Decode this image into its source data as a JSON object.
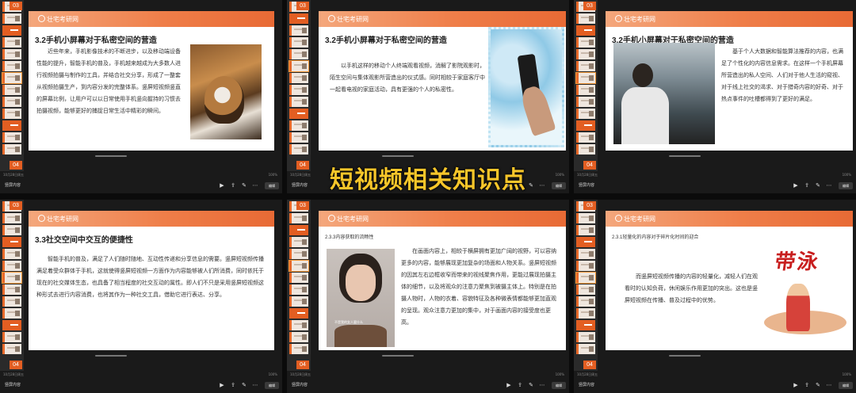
{
  "app": {
    "doc_name": "竖屏内容",
    "edit_label": "编辑",
    "status_time": "10月28日周五",
    "battery": "100%"
  },
  "overlay_caption": "短视频相关知识点",
  "logo_text": "壮宅考研网",
  "icons": [
    "play-icon",
    "share-icon",
    "pen-icon",
    "more-icon"
  ],
  "slides": [
    {
      "title": "3.2手机小屏幕对于私密空间的营造",
      "body": "近些年来，手机影像技术的不断进步，以及移动端设备性能的提升，智能手机的普及，手机越来越成为大多数人进行视频拍摄与制作的工具，并结合社交分享，形成了一整套从视频拍摄生产，到内容分发的完整体系。竖屏短视频竖直的屏幕比例，让用户可以以日常使用手机竖向握持的习惯去拍摄视频，能够更好的捕捉日常生活中精彩的瞬间。",
      "top_num": "03",
      "bot_num": "04"
    },
    {
      "title": "3.2手机小屏幕对于私密空间的营造",
      "body": "以手机这样的移动个人终端观看视频，消解了影院观影时，陌生空间与集体观影所营造出的仪式感。同时相较于家庭客厅中一起看电视的家庭活动，具有更强的个人的私密性。",
      "top_num": "03",
      "bot_num": "04"
    },
    {
      "title": "3.2手机小屏幕对于私密空间的营造",
      "body": "基于个人大数据和智能算法推荐的内容，也满足了个性化的内容信息需求。在这样一个手机屏幕所营造出的私人空间、人们对于他人生活的窥视、对于线上社交的渴求、对于猎奇内容的好奇、对于热点事件的吐槽都得到了更好的满足。",
      "top_num": "03",
      "bot_num": "04"
    },
    {
      "title": "3.3社交空间中交互的便捷性",
      "body": "智能手机的普及，满足了人们随时随地、互动性传递和分享信息的需要。竖屏短视频传播满足着受众群体于手机，这就使得竖屏短视频一方面作为内容能够被人们所消费，同时依托于现在的社交媒体生态，也具备了相当程度的社交互动的属性。即人们不只是采用竖屏短视频这种形式去进行内容消费，也将其作为一种社交工具，借助它进行表达、分享。",
      "top_num": "03",
      "bot_num": "04"
    },
    {
      "title": "2.3.3内容获取的流畅性",
      "body": "在画面内容上，相较于横屏拥有更加广阔的视野，可以容纳更多的内容，能够展现更加复杂的场面和人物关系。竖屏短视频的因其左右边框收窄而带来的视线聚焦作用，更能过展现拍摄主体的细节，以及将观众的注意力聚焦到被摄主体上。特别是在拍摄人物时，人物的衣着、容貌特征及各种微表情都能够更加直观的呈现。观众注意力更加的集中，对于画面内容的接受度也更高。",
      "top_num": "03",
      "bot_num": "04",
      "photo_caption": "不是我的女人要什么"
    },
    {
      "title": "2.3.1轻量化的内容对于碎片化时间的迎合",
      "body": "而竖屏短视频传播的内容的轻量化，减轻人们在观看时的认知负荷，休闲娱乐作用更加的突出。这也是竖屏短视频在传播、普及过程中的优势。",
      "top_num": "03",
      "bot_num": "04",
      "art_text": "带泳"
    }
  ]
}
